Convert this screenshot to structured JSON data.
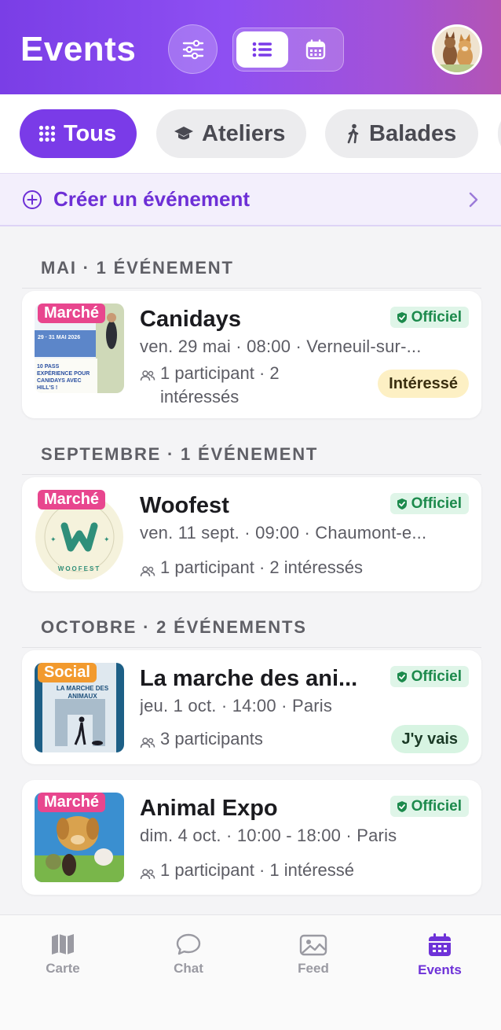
{
  "header": {
    "title": "Events",
    "avatar_alt": ""
  },
  "categories": [
    {
      "label": "Tous",
      "icon": "grid-icon",
      "active": true
    },
    {
      "label": "Ateliers",
      "icon": "graduation-cap-icon",
      "active": false
    },
    {
      "label": "Balades",
      "icon": "walking-icon",
      "active": false
    }
  ],
  "create": {
    "label": "Créer un événement"
  },
  "sections": [
    {
      "label": "MAI · 1 ÉVÉNEMENT"
    },
    {
      "label": "SEPTEMBRE · 1 ÉVÉNEMENT"
    },
    {
      "label": "OCTOBRE · 2 ÉVÉNEMENTS"
    }
  ],
  "events": [
    {
      "tag": "Marché",
      "name": "Canidays",
      "official": "Officiel",
      "when": "ven. 29 mai · 08:00 · Verneuil-sur-...",
      "people_line1": "1 participant · 2",
      "people_line2": "intéressés",
      "status": "Intéressé",
      "thumb_text": {
        "dates": "29 · 31 MAI 2026",
        "promo": "10 PASS EXPÉRIENCE POUR CANIDAYS AVEC HILL'S !"
      }
    },
    {
      "tag": "Marché",
      "name": "Woofest",
      "official": "Officiel",
      "when": "ven. 11 sept. · 09:00 · Chaumont-e...",
      "people": "1 participant · 2 intéressés",
      "status": "",
      "thumb_text": {
        "ring": "WOOFEST"
      }
    },
    {
      "tag": "Social",
      "name": "La marche des ani...",
      "official": "Officiel",
      "when": "jeu. 1 oct. · 14:00 · Paris",
      "people": "3 participants",
      "status": "J'y vais",
      "thumb_text": {
        "title": "LA MARCHE DES ANIMAUX"
      }
    },
    {
      "tag": "Marché",
      "name": "Animal Expo",
      "official": "Officiel",
      "when": "dim. 4 oct. · 10:00 - 18:00 · Paris",
      "people": "1 participant · 1 intéressé",
      "status": ""
    }
  ],
  "nav": [
    {
      "label": "Carte",
      "icon": "map-icon",
      "active": false
    },
    {
      "label": "Chat",
      "icon": "chat-bubble-icon",
      "active": false
    },
    {
      "label": "Feed",
      "icon": "gallery-icon",
      "active": false
    },
    {
      "label": "Events",
      "icon": "calendar-icon",
      "active": true
    }
  ],
  "colors": {
    "accent": "#7a3be8",
    "official_bg": "#dff5e8",
    "official_text": "#1c8a4c",
    "tag_marche": "#e8468e",
    "tag_social": "#f29a2e"
  }
}
